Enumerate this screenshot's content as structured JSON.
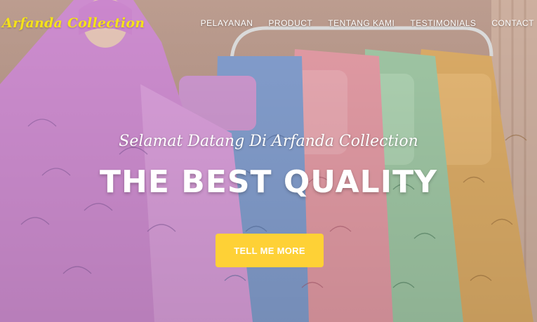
{
  "brand": {
    "name": "Arfanda Collection",
    "color": "#f5e21a"
  },
  "nav": {
    "items": [
      {
        "label": "PELAYANAN"
      },
      {
        "label": "PRODUCT"
      },
      {
        "label": "TENTANG KAMI"
      },
      {
        "label": "TESTIMONIALS"
      },
      {
        "label": "CONTACT"
      }
    ]
  },
  "hero": {
    "subheading": "Selamat Datang Di Arfanda Collection",
    "heading": "THE BEST QUALITY",
    "cta_label": "TELL ME MORE",
    "cta_color": "#fed136"
  }
}
